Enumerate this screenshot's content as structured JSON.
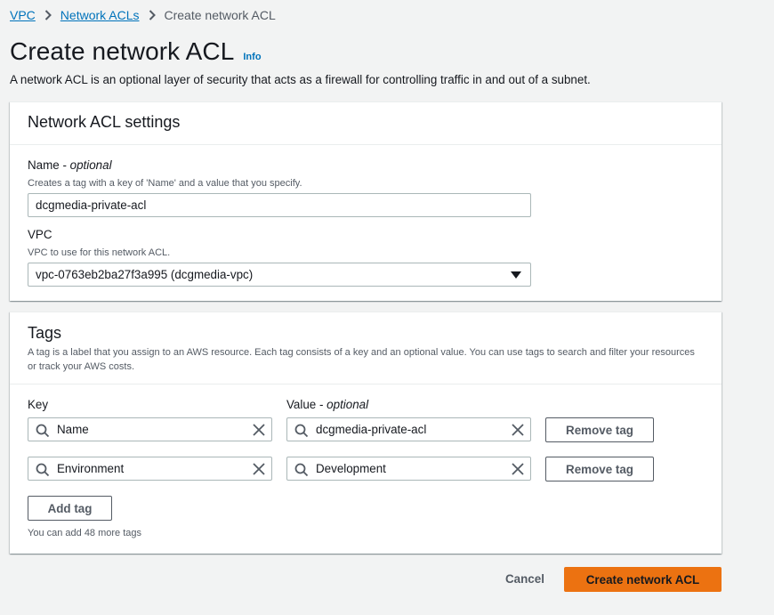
{
  "breadcrumb": {
    "items": [
      "VPC",
      "Network ACLs"
    ],
    "current": "Create network ACL"
  },
  "header": {
    "title": "Create network ACL",
    "info_label": "Info",
    "description": "A network ACL is an optional layer of security that acts as a firewall for controlling traffic in and out of a subnet."
  },
  "settings": {
    "title": "Network ACL settings",
    "name_label": "Name",
    "name_optional": "optional",
    "name_hint": "Creates a tag with a key of 'Name' and a value that you specify.",
    "name_value": "dcgmedia-private-acl",
    "vpc_label": "VPC",
    "vpc_hint": "VPC to use for this network ACL.",
    "vpc_value": "vpc-0763eb2ba27f3a995 (dcgmedia-vpc)"
  },
  "tags": {
    "title": "Tags",
    "description": "A tag is a label that you assign to an AWS resource. Each tag consists of a key and an optional value. You can use tags to search and filter your resources or track your AWS costs.",
    "key_header": "Key",
    "value_header": "Value",
    "value_optional": "optional",
    "rows": [
      {
        "key": "Name",
        "value": "dcgmedia-private-acl",
        "remove_label": "Remove tag"
      },
      {
        "key": "Environment",
        "value": "Development",
        "remove_label": "Remove tag"
      }
    ],
    "add_label": "Add tag",
    "remaining_text": "You can add 48 more tags"
  },
  "footer": {
    "cancel_label": "Cancel",
    "submit_label": "Create network ACL"
  },
  "colors": {
    "link": "#0073bb",
    "primary": "#ec7211",
    "background": "#f2f3f3"
  },
  "icons": [
    "chevron-right-icon",
    "search-icon",
    "clear-icon",
    "caret-down-icon"
  ]
}
